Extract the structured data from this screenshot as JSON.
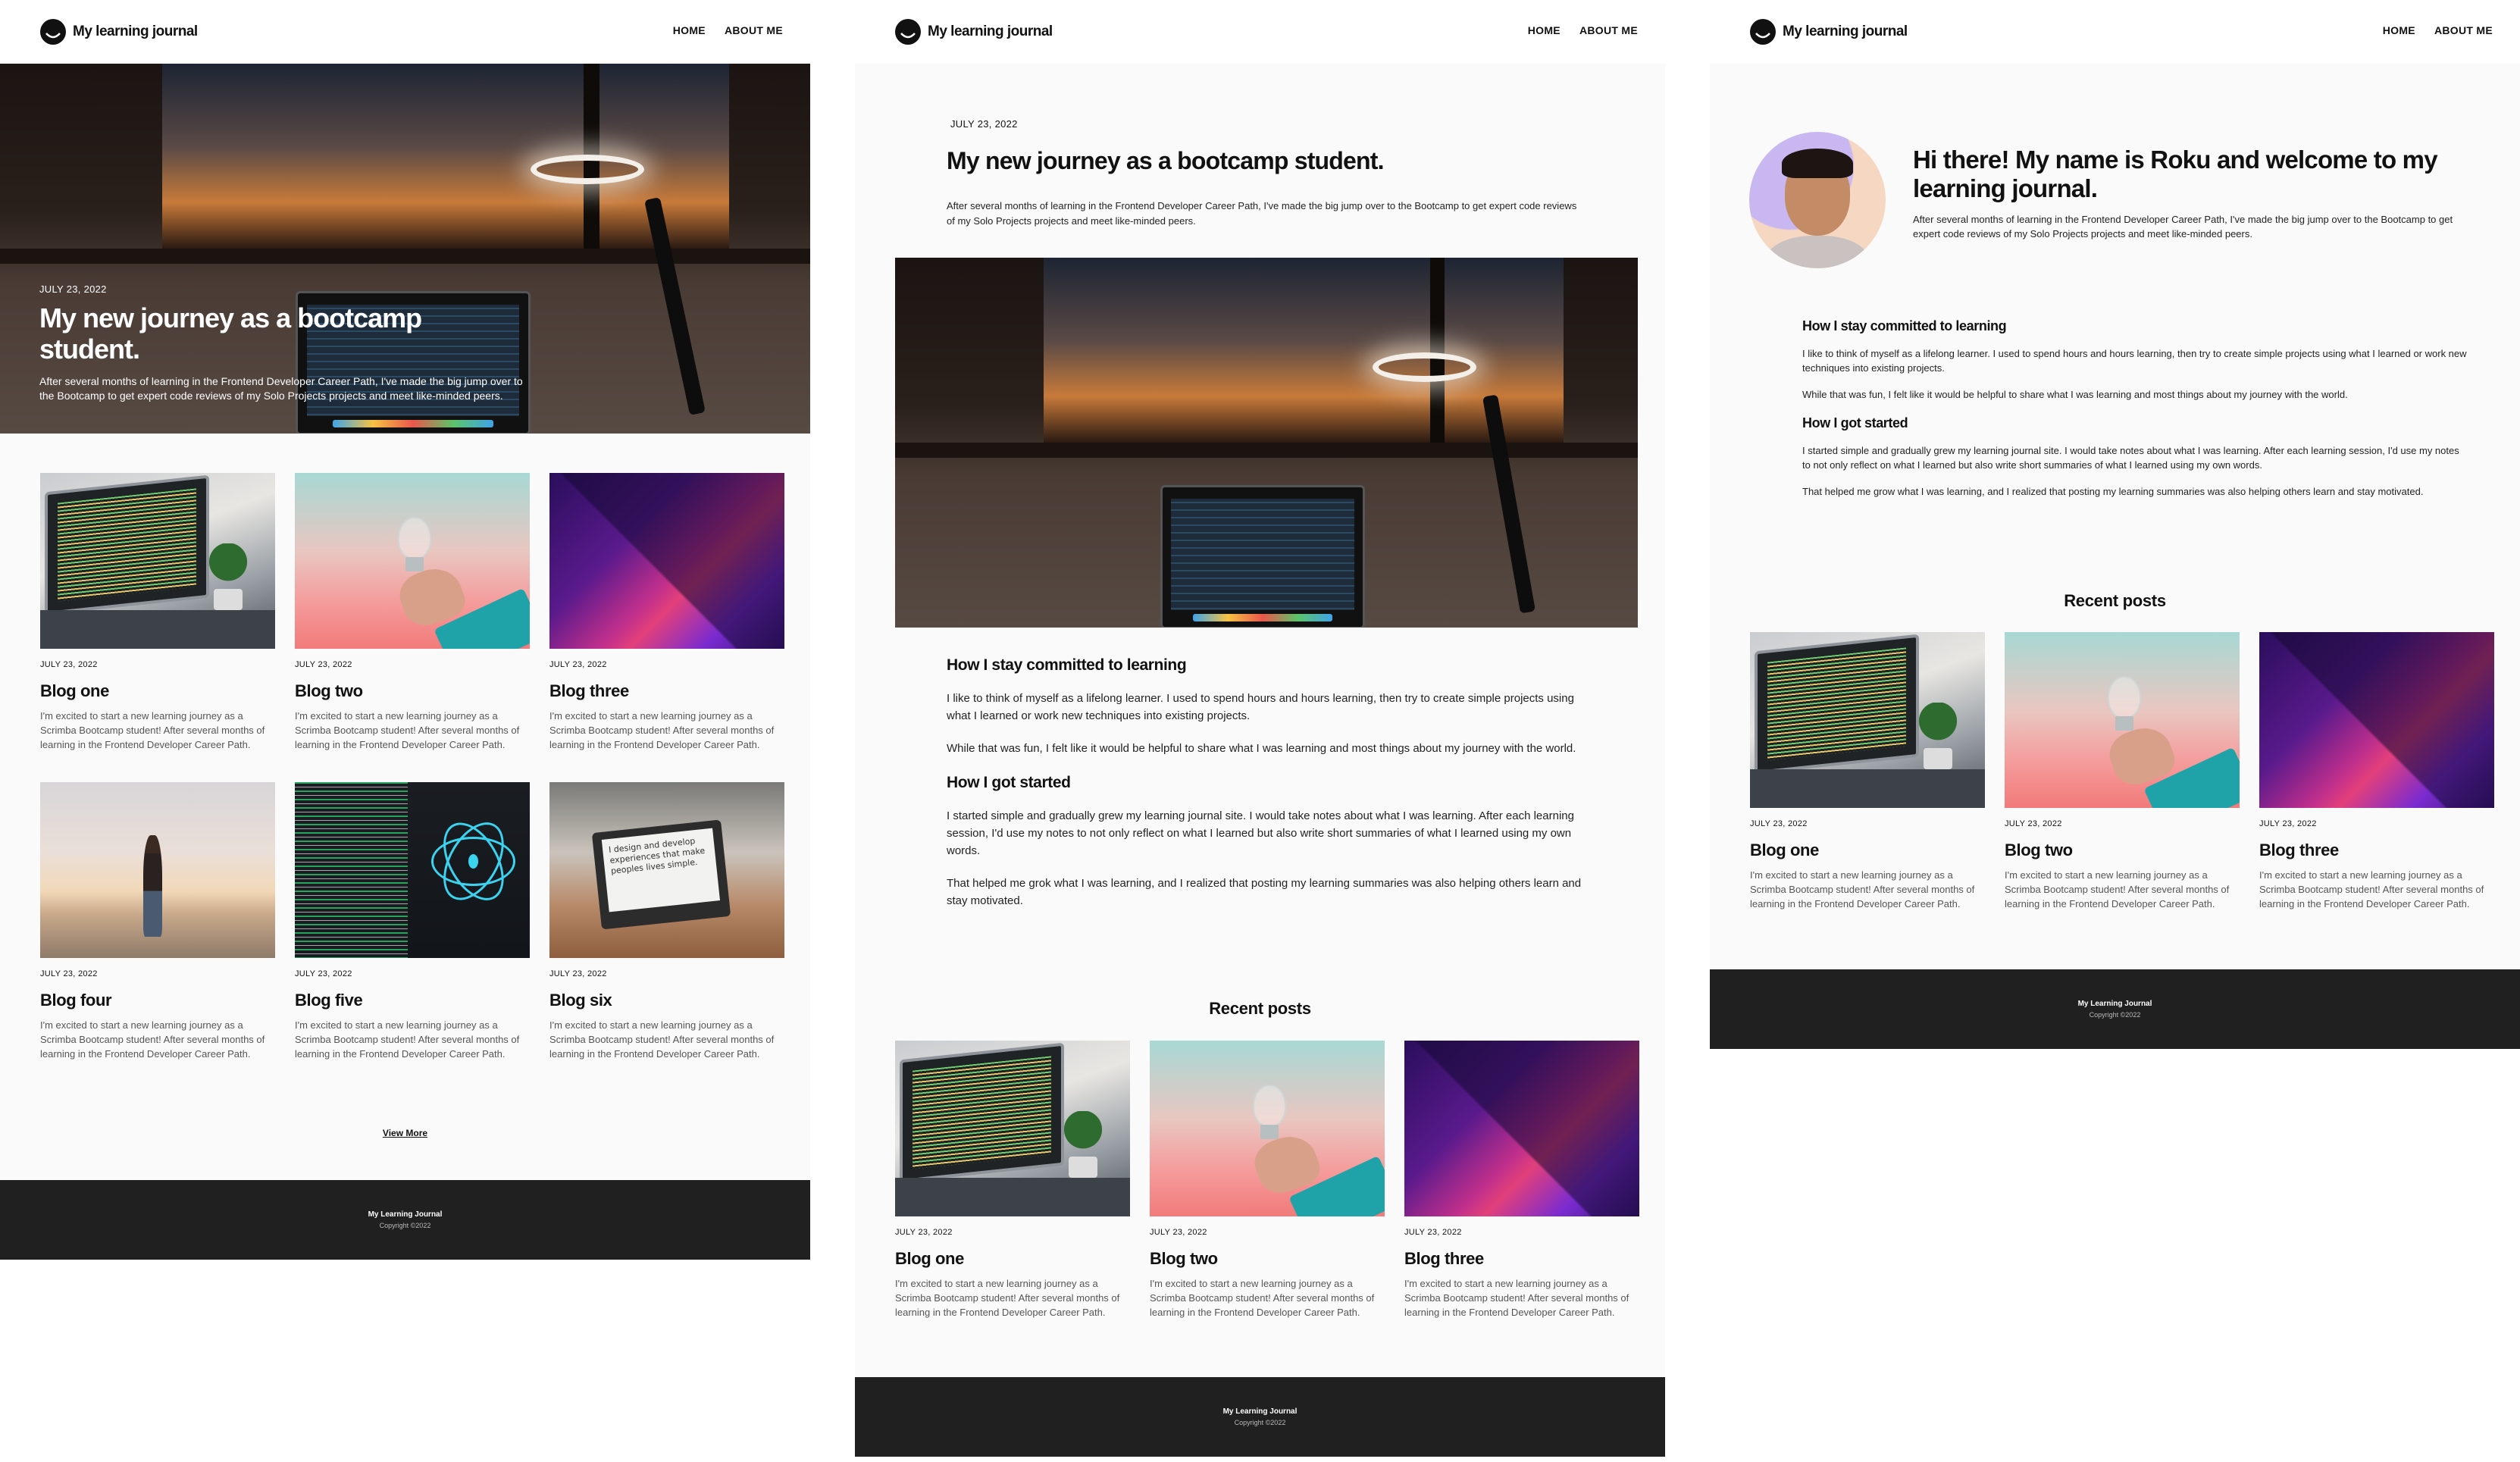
{
  "site": {
    "logo_text": "My learning journal",
    "nav": {
      "home": "HOME",
      "about": "ABOUT ME"
    },
    "footer": {
      "brand": "My Learning Journal",
      "copyright": "Copyright ©2022"
    }
  },
  "home": {
    "hero": {
      "date": "JULY 23, 2022",
      "title": "My new journey as a bootcamp student.",
      "excerpt": "After several months of learning in the Frontend Developer Career Path, I've made the big jump over to the Bootcamp to get expert code reviews of my Solo Projects projects and meet like-minded peers."
    },
    "posts": [
      {
        "date": "JULY 23, 2022",
        "title": "Blog one",
        "excerpt": "I'm excited to start a new learning journey as a Scrimba Bootcamp student! After several months of learning in the Frontend Developer Career Path."
      },
      {
        "date": "JULY 23, 2022",
        "title": "Blog two",
        "excerpt": "I'm excited to start a new learning journey as a Scrimba Bootcamp student! After several months of learning in the Frontend Developer Career Path."
      },
      {
        "date": "JULY 23, 2022",
        "title": "Blog three",
        "excerpt": "I'm excited to start a new learning journey as a Scrimba Bootcamp student! After several months of learning in the Frontend Developer Career Path."
      },
      {
        "date": "JULY 23, 2022",
        "title": "Blog four",
        "excerpt": "I'm excited to start a new learning journey as a Scrimba Bootcamp student! After several months of learning in the Frontend Developer Career Path."
      },
      {
        "date": "JULY 23, 2022",
        "title": "Blog five",
        "excerpt": "I'm excited to start a new learning journey as a Scrimba Bootcamp student! After several months of learning in the Frontend Developer Career Path."
      },
      {
        "date": "JULY 23, 2022",
        "title": "Blog six",
        "excerpt": "I'm excited to start a new learning journey as a Scrimba Bootcamp student! After several months of learning in the Frontend Developer Career Path."
      }
    ],
    "view_more": "View More"
  },
  "post": {
    "date": "JULY 23, 2022",
    "title": "My new journey as a bootcamp student.",
    "intro": "After several months of learning in the Frontend Developer Career Path, I've made the big jump over to the Bootcamp to get expert code reviews of my Solo Projects projects and meet like-minded peers.",
    "sections": [
      {
        "heading": "How I stay committed to learning",
        "paragraphs": [
          "I like to think of myself as a lifelong learner. I used to spend hours and hours learning, then try to create simple projects using what I learned or work new techniques into existing projects.",
          "While that was fun, I felt like it would be helpful to share what I was learning and most things about my journey with the world."
        ]
      },
      {
        "heading": "How I got started",
        "paragraphs": [
          "I started simple and gradually grew my learning journal site. I would take notes about what I was learning. After each learning session, I'd use my notes to not only reflect on what I learned but also write short summaries of what I learned using my own words.",
          "That helped me grok what I was learning, and I realized that posting my learning summaries was also helping others learn and stay motivated."
        ]
      }
    ],
    "recent_label": "Recent posts",
    "recent": [
      {
        "date": "JULY 23, 2022",
        "title": "Blog one",
        "excerpt": "I'm excited to start a new learning journey as a Scrimba Bootcamp student! After several months of learning in the Frontend Developer Career Path."
      },
      {
        "date": "JULY 23, 2022",
        "title": "Blog two",
        "excerpt": "I'm excited to start a new learning journey as a Scrimba Bootcamp student! After several months of learning in the Frontend Developer Career Path."
      },
      {
        "date": "JULY 23, 2022",
        "title": "Blog three",
        "excerpt": "I'm excited to start a new learning journey as a Scrimba Bootcamp student! After several months of learning in the Frontend Developer Career Path."
      }
    ]
  },
  "about": {
    "title": "Hi there! My name is Roku and welcome to my learning journal.",
    "intro": "After several months of learning in the Frontend Developer Career Path, I've made the big jump over to the Bootcamp to get expert code reviews of my Solo Projects projects and meet like-minded peers.",
    "sections": [
      {
        "heading": "How I stay committed to learning",
        "paragraphs": [
          "I like to think of myself as a lifelong learner. I used to spend hours and hours learning, then try to create simple projects using what I learned or work new techniques into existing projects.",
          "While that was fun, I felt like it would be helpful to share what I was learning and most things about my journey with the world."
        ]
      },
      {
        "heading": "How I got started",
        "paragraphs": [
          "I started simple and gradually grew my learning journal site. I would take notes about what I was learning. After each learning session, I'd use my notes to not only reflect on what I learned but also write short summaries of what I learned using my own words.",
          "That helped me grow what I was learning, and I realized that posting my learning summaries was also helping others learn and stay motivated."
        ]
      }
    ],
    "recent_label": "Recent posts",
    "recent": [
      {
        "date": "JULY 23, 2022",
        "title": "Blog one",
        "excerpt": "I'm excited to start a new learning journey as a Scrimba Bootcamp student! After several months of learning in the Frontend Developer Career Path."
      },
      {
        "date": "JULY 23, 2022",
        "title": "Blog two",
        "excerpt": "I'm excited to start a new learning journey as a Scrimba Bootcamp student! After several months of learning in the Frontend Developer Career Path."
      },
      {
        "date": "JULY 23, 2022",
        "title": "Blog three",
        "excerpt": "I'm excited to start a new learning journey as a Scrimba Bootcamp student! After several months of learning in the Frontend Developer Career Path."
      }
    ]
  },
  "images": {
    "hero": "desk-laptop-lamp-photo",
    "blog_one": "code-laptop-plant-photo",
    "blog_two": "lightbulb-hand-photo",
    "blog_three": "purple-abstract-photo",
    "blog_four": "beach-person-photo",
    "blog_five": "react-code-screen-photo",
    "blog_six": "laptop-sign-photo",
    "avatar": "profile-photo"
  },
  "sign_text": "I design and develop experiences that make peoples lives simple."
}
